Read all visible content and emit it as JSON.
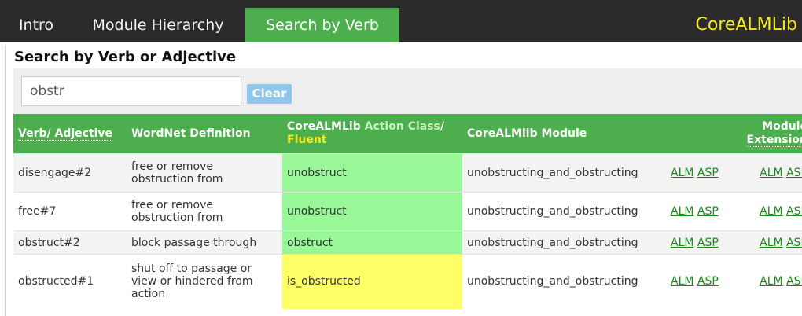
{
  "nav": {
    "tabs": [
      {
        "label": "Intro",
        "active": false
      },
      {
        "label": "Module Hierarchy",
        "active": false
      },
      {
        "label": "Search by Verb",
        "active": true
      }
    ],
    "brand": "CoreALMLib"
  },
  "page": {
    "title": "Search by Verb or Adjective"
  },
  "search": {
    "value": "obstr",
    "clear_label": "Clear"
  },
  "table": {
    "headers": {
      "verb": "Verb/ Adjective",
      "definition": "WordNet Definition",
      "class_prefix": "CoreALMLib",
      "class_action": "Action Class",
      "class_slash": "/",
      "class_fluent": "Fluent",
      "module": "CoreALMlib Module",
      "ext_line1": "Module",
      "ext_line2": "Extension"
    },
    "link_alm": "ALM",
    "link_asp": "ASP",
    "rows": [
      {
        "verb": "disengage#2",
        "definition": "free or remove obstruction from",
        "class": "unobstruct",
        "class_type": "action",
        "module": "unobstructing_and_obstructing"
      },
      {
        "verb": "free#7",
        "definition": "free or remove obstruction from",
        "class": "unobstruct",
        "class_type": "action",
        "module": "unobstructing_and_obstructing"
      },
      {
        "verb": "obstruct#2",
        "definition": "block passage through",
        "class": "obstruct",
        "class_type": "action",
        "module": "unobstructing_and_obstructing"
      },
      {
        "verb": "obstructed#1",
        "definition": "shut off to passage or view or hindered from action",
        "class": "is_obstructed",
        "class_type": "fluent",
        "module": "unobstructing_and_obstructing"
      }
    ]
  },
  "colors": {
    "navbar": "#2b2b2b",
    "accent_green": "#4cae4c",
    "brand_yellow": "#f7ea1c",
    "action_cell": "#98f898",
    "fluent_cell": "#ffff66",
    "clear_button": "#8fc7ea",
    "link": "#1a8a1a"
  }
}
